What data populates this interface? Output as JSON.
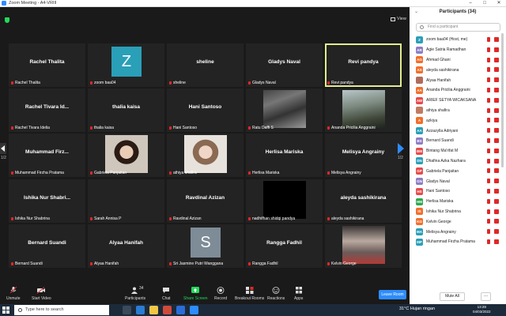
{
  "window": {
    "title": "Zoom Meeting - A4-VRIII"
  },
  "view_label": "View",
  "tiles": [
    {
      "name": "Rachel Thalita",
      "label": "Rachel Thalita"
    },
    {
      "name": "",
      "label": "zoom baa04",
      "avatar": "Z"
    },
    {
      "name": "sheline",
      "label": "sheline"
    },
    {
      "name": "Gladys Naval",
      "label": "Gladys Naval"
    },
    {
      "name": "Revi pandya",
      "label": "Revi pandya",
      "active": true
    },
    {
      "name": "Rachel Tivara Id...",
      "label": "Rachel Tivara Idelia"
    },
    {
      "name": "thalia kaisa",
      "label": "thalia kaisa"
    },
    {
      "name": "Hani Santoso",
      "label": "Hani Santoso"
    },
    {
      "name": "",
      "label": "Ratu Daffi S",
      "photo": "street"
    },
    {
      "name": "",
      "label": "Ananda Pricilia Anggraini",
      "photo": "outdoor"
    },
    {
      "name": "Muhammad Firz...",
      "label": "Muhammad Firzha Pratama"
    },
    {
      "name": "",
      "label": "Gabriela Panjaitan",
      "photo": "girl"
    },
    {
      "name": "",
      "label": "athiya shafira",
      "photo": "girl2"
    },
    {
      "name": "Herlisa Mariska",
      "label": "Herlisa Mariska"
    },
    {
      "name": "Melisya Angrainy",
      "label": "Melisya Angrainy"
    },
    {
      "name": "Ishika Nur Shabri...",
      "label": "Ishika Nur Shabrina"
    },
    {
      "name": "",
      "label": "Sarah Annisa P"
    },
    {
      "name": "Ravdinal Azizan",
      "label": "Ravdinal Azizan"
    },
    {
      "name": "",
      "label": "nadhifhan shidqi pandya",
      "photo": "dark"
    },
    {
      "name": "aleyda sashikirana",
      "label": "aleyda sashikirana"
    },
    {
      "name": "Bernard Suandi",
      "label": "Bernard Suandi"
    },
    {
      "name": "Alyaa Hanifah",
      "label": "Alyaa Hanifah"
    },
    {
      "name": "",
      "label": "Sri Jasmine Putri Wanggana",
      "avatar": "S"
    },
    {
      "name": "Rangga Fadhil",
      "label": "Rangga Fadhil"
    },
    {
      "name": "",
      "label": "Kelvin George",
      "photo": "dog"
    }
  ],
  "page_left": "1/2",
  "page_right": "1/2",
  "toolbar": {
    "unmute": "Unmute",
    "start_video": "Start Video",
    "participants": "Participants",
    "participants_count": "34",
    "chat": "Chat",
    "share_screen": "Share Screen",
    "record": "Record",
    "breakout": "Breakout Rooms",
    "reactions": "Reactions",
    "apps": "Apps",
    "leave": "Leave Room"
  },
  "panel": {
    "title": "Participants (34)",
    "search_placeholder": "Find a participant",
    "mute_all": "Mute All",
    "more": "...",
    "participants": [
      {
        "initials": "Z",
        "name": "zoom baa04 (Host, me)",
        "color": "#2a9fb8"
      },
      {
        "initials": "AR",
        "name": "Agie Satria Ramadhan",
        "color": "#8e7dc4"
      },
      {
        "initials": "AG",
        "name": "Ahmad Ghani",
        "color": "#f36e2a"
      },
      {
        "initials": "AS",
        "name": "aleyda sashikirana",
        "color": "#f36e2a"
      },
      {
        "initials": "",
        "name": "Alyaa Hanifah",
        "color": "#b06b5a"
      },
      {
        "initials": "AA",
        "name": "Ananda Pricilia Anggraini",
        "color": "#f36e2a"
      },
      {
        "initials": "AW",
        "name": "ARIEF SETYA WICAKSANA",
        "color": "#e84a4a"
      },
      {
        "initials": "",
        "name": "athiya shafira",
        "color": "#c27a60"
      },
      {
        "initials": "A",
        "name": "azkiya",
        "color": "#f36e2a"
      },
      {
        "initials": "AA",
        "name": "Azzazylla Adriyani",
        "color": "#2a9fb8"
      },
      {
        "initials": "BS",
        "name": "Bernard Suandi",
        "color": "#8e7dc4"
      },
      {
        "initials": "BM",
        "name": "Bintang Ma'rifat M",
        "color": "#e84a4a"
      },
      {
        "initials": "DN",
        "name": "Dhafina Azka Nazhara",
        "color": "#2a9fb8"
      },
      {
        "initials": "GP",
        "name": "Gabriela Panjaitan",
        "color": "#e84a4a"
      },
      {
        "initials": "GN",
        "name": "Gladys Naval",
        "color": "#8e7dc4"
      },
      {
        "initials": "HS",
        "name": "Hani Santoso",
        "color": "#e84a4a"
      },
      {
        "initials": "HM",
        "name": "Herlisa Mariska",
        "color": "#2fa84f"
      },
      {
        "initials": "IS",
        "name": "Ishika Nur Shabrina",
        "color": "#f36e2a"
      },
      {
        "initials": "KG",
        "name": "Kelvin George",
        "color": "#f36e2a"
      },
      {
        "initials": "MA",
        "name": "Melisya Angrainy",
        "color": "#2a9fb8"
      },
      {
        "initials": "MP",
        "name": "Muhammad Firzha Pratama",
        "color": "#2a9fb8"
      }
    ]
  },
  "taskbar": {
    "search_placeholder": "Type here to search",
    "weather": "31°C  Hujan ringan",
    "time": "13:28",
    "date": "04/03/2022"
  },
  "colors": {
    "accent": "#2d8cff",
    "active_border": "#e2ec8f",
    "muted": "#e02828",
    "share": "#23d959"
  }
}
